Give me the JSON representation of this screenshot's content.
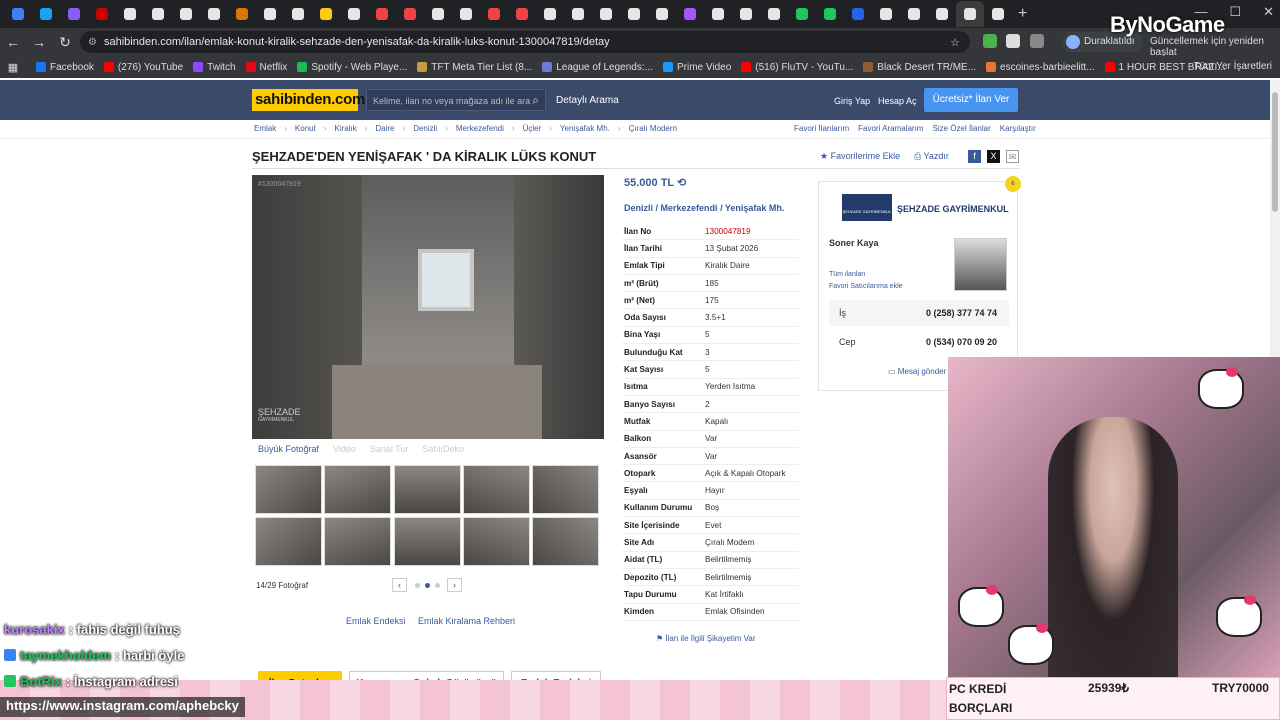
{
  "browser": {
    "url": "sahibinden.com/ilan/emlak-konut-kiralik-sehzade-den-yenisafak-da-kiralik-luks-konut-1300047819/detay",
    "profile_status": "Duraklatıldı",
    "restart_text": "Güncellemek için yeniden başlat",
    "tab_colors": [
      "#3b82f6",
      "#1da1f2",
      "#8b5cf6",
      "#cc0000",
      "#e5e5e5",
      "#e5e5e5",
      "#e5e5e5",
      "#e5e5e5",
      "#d97706",
      "#e5e5e5",
      "#e5e5e5",
      "#facc15",
      "#e5e5e5",
      "#ef4444",
      "#ef4444",
      "#e5e5e5",
      "#e5e5e5",
      "#ef4444",
      "#ef4444",
      "#e5e5e5",
      "#e5e5e5",
      "#e5e5e5",
      "#e5e5e5",
      "#e5e5e5",
      "#a855f7",
      "#e5e5e5",
      "#e5e5e5",
      "#e5e5e5",
      "#22c55e",
      "#22c55e",
      "#2563eb",
      "#e5e5e5",
      "#e5e5e5",
      "#e5e5e5",
      "#e5e5e5",
      "#e5e5e5"
    ],
    "bookmarks": [
      {
        "label": "Facebook",
        "color": "#1877f2"
      },
      {
        "label": "(276) YouTube",
        "color": "#ff0000"
      },
      {
        "label": "Twitch",
        "color": "#9146ff"
      },
      {
        "label": "Netflix",
        "color": "#e50914"
      },
      {
        "label": "Spotify - Web Playe...",
        "color": "#1db954"
      },
      {
        "label": "TFT Meta Tier List (8...",
        "color": "#c89b3c"
      },
      {
        "label": "League of Legends:...",
        "color": "#6c7bd8"
      },
      {
        "label": "Prime Video",
        "color": "#1a98ff"
      },
      {
        "label": "(516) FluTV - YouTu...",
        "color": "#ff0000"
      },
      {
        "label": "Black Desert TR/ME...",
        "color": "#8b5e3c"
      },
      {
        "label": "escoines-barbieelitt...",
        "color": "#e8782d"
      },
      {
        "label": "1 HOUR BEST BRAZI...",
        "color": "#ff0000"
      }
    ],
    "all_bookmarks": "Tüm Yer İşaretleri"
  },
  "watermark": "ByNoGame",
  "site": {
    "logo": "sahibinden.com",
    "search_placeholder": "Kelime, ilan no veya mağaza adı ile ara",
    "detailed_search": "Detaylı Arama",
    "login": "Giriş Yap",
    "register": "Hesap Aç",
    "free_ad": "Ücretsiz* İlan Ver"
  },
  "breadcrumb": [
    "Emlak",
    "Konut",
    "Kiralık",
    "Daire",
    "Denizli",
    "Merkezefendi",
    "Üçler",
    "Yenişafak Mh.",
    "Çıralı Modern"
  ],
  "top_links": [
    "Favori İlanlarım",
    "Favori Aramalarım",
    "Size Özel İlanlar",
    "Karşılaştır"
  ],
  "listing": {
    "title": "ŞEHZADE'DEN YENİŞAFAK ' DA KİRALIK LÜKS KONUT",
    "add_favorite": "Favorilerime Ekle",
    "print": "Yazdır",
    "photo_id": "#1300047819",
    "photo_stamp": "ŞEHZADE",
    "photo_stamp_sub": "GAYRİMENKUL",
    "photo_tabs": [
      "Büyük Fotoğraf",
      "Video",
      "Sanal Tur",
      "SatılıDeko"
    ],
    "photo_count": "14/29 Fotoğraf",
    "price": "55.000 TL",
    "location": [
      "Denizli",
      "Merkezefendi",
      "Yenişafak Mh."
    ],
    "details": [
      {
        "k": "İlan No",
        "v": "1300047819"
      },
      {
        "k": "İlan Tarihi",
        "v": "13 Şubat 2026"
      },
      {
        "k": "Emlak Tipi",
        "v": "Kiralık Daire"
      },
      {
        "k": "m² (Brüt)",
        "v": "185"
      },
      {
        "k": "m² (Net)",
        "v": "175"
      },
      {
        "k": "Oda Sayısı",
        "v": "3.5+1"
      },
      {
        "k": "Bina Yaşı",
        "v": "5"
      },
      {
        "k": "Bulunduğu Kat",
        "v": "3"
      },
      {
        "k": "Kat Sayısı",
        "v": "5"
      },
      {
        "k": "Isıtma",
        "v": "Yerden Isıtma"
      },
      {
        "k": "Banyo Sayısı",
        "v": "2"
      },
      {
        "k": "Mutfak",
        "v": "Kapalı"
      },
      {
        "k": "Balkon",
        "v": "Var"
      },
      {
        "k": "Asansör",
        "v": "Var"
      },
      {
        "k": "Otopark",
        "v": "Açık & Kapalı Otopark"
      },
      {
        "k": "Eşyalı",
        "v": "Hayır"
      },
      {
        "k": "Kullanım Durumu",
        "v": "Boş"
      },
      {
        "k": "Site İçerisinde",
        "v": "Evet"
      },
      {
        "k": "Site Adı",
        "v": "Çıralı Modern"
      },
      {
        "k": "Aidat (TL)",
        "v": "Belirtilmemiş"
      },
      {
        "k": "Depozito (TL)",
        "v": "Belirtilmemiş"
      },
      {
        "k": "Tapu Durumu",
        "v": "Kat İrtifaklı"
      },
      {
        "k": "Kimden",
        "v": "Emlak Ofisinden"
      }
    ],
    "complaint": "İlan ile İlgili Şikayetim Var"
  },
  "seller": {
    "company": "ŞEHZADE GAYRİMENKUL",
    "logo_text": "ŞEHZADE GAYRİMENKUL",
    "agent": "Soner Kaya",
    "all_listings": "Tüm ilanları",
    "fav_seller": "Favori Satıcılarıma ekle",
    "phones": [
      {
        "label": "İş",
        "value": "0 (258) 377 74 74"
      },
      {
        "label": "Cep",
        "value": "0 (534) 070 09 20"
      }
    ],
    "message": "Mesaj gönder"
  },
  "lower_links": {
    "index": "Emlak Endeksi",
    "guide": "Emlak Kiralama Rehberi"
  },
  "lower_tabs": [
    "İlan Detayları",
    "Konumu ve Sokak Görünümü",
    "Emlak Endeksi"
  ],
  "stream": {
    "chat": [
      {
        "user": "kurosakix",
        "msg": "fahis değil fuhuş",
        "color": "#c084fc"
      },
      {
        "user": "taymekholdem",
        "msg": "harbi öyle",
        "color": "#22c55e"
      },
      {
        "user": "BotRix",
        "msg": "İnstagram adresi",
        "color": "#22c55e"
      }
    ],
    "instagram": "https://www.instagram.com/aphebcky",
    "kredi_label": "PC KREDİ BORÇLARI",
    "kredi_value_a": "25939₺",
    "kredi_value_b": "TRY70000"
  }
}
